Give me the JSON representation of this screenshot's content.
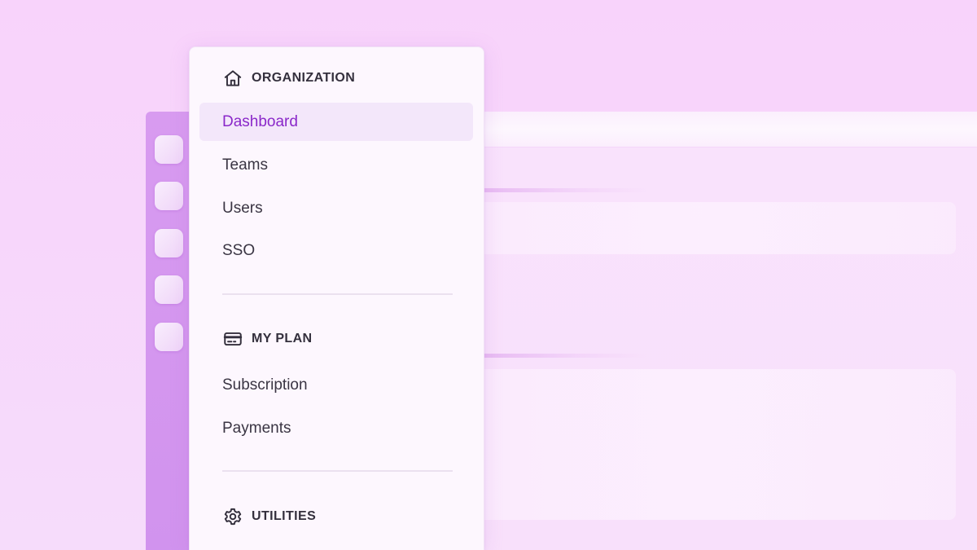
{
  "menu": {
    "sections": [
      {
        "title": "ORGANIZATION",
        "icon": "home-icon",
        "items": [
          {
            "label": "Dashboard",
            "active": true
          },
          {
            "label": "Teams",
            "active": false
          },
          {
            "label": "Users",
            "active": false
          },
          {
            "label": "SSO",
            "active": false
          }
        ]
      },
      {
        "title": "MY PLAN",
        "icon": "credit-card-icon",
        "items": [
          {
            "label": "Subscription",
            "active": false
          },
          {
            "label": "Payments",
            "active": false
          }
        ]
      },
      {
        "title": "UTILITIES",
        "icon": "gear-icon",
        "items": []
      }
    ]
  },
  "colors": {
    "accent": "#8a28c9",
    "active_background": "#f3e7fa",
    "rail": "#d193ee",
    "page_background": "#f8d3fb"
  }
}
